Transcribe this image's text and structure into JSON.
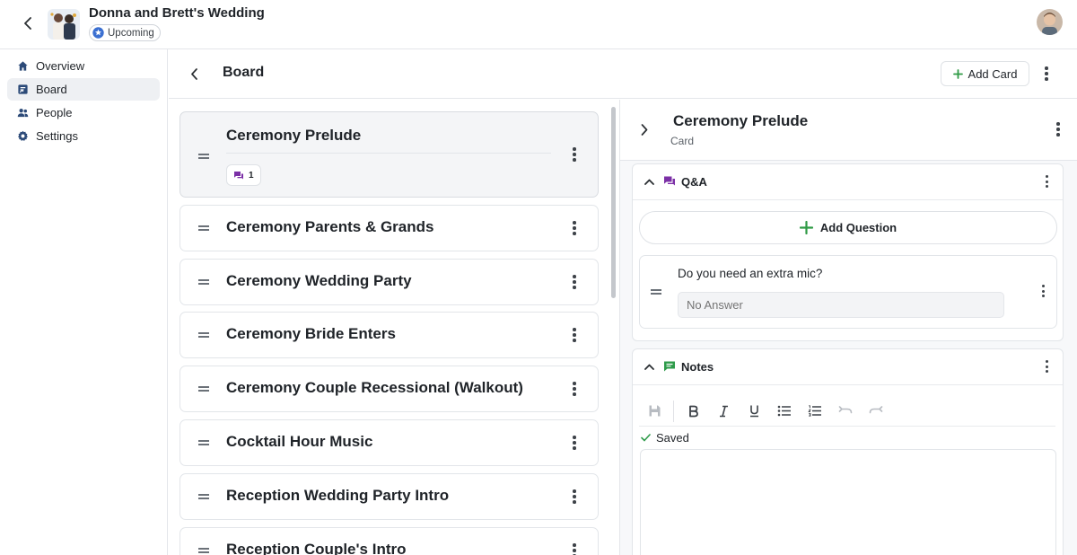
{
  "app": {
    "event_title": "Donna and Brett's Wedding",
    "status": "Upcoming",
    "colors": {
      "accent": "#2f7a3a",
      "qa_purple": "#7b2fa6",
      "notes_green": "#2e9b4a",
      "status_blue": "#3b6fd1"
    }
  },
  "sidebar": {
    "items": [
      {
        "label": "Overview",
        "icon": "home-icon"
      },
      {
        "label": "Board",
        "icon": "board-icon"
      },
      {
        "label": "People",
        "icon": "people-icon"
      },
      {
        "label": "Settings",
        "icon": "gear-icon"
      }
    ],
    "active": "Board"
  },
  "board": {
    "title": "Board",
    "add_card_label": "Add Card",
    "cards": [
      {
        "name": "Ceremony Prelude",
        "qa_count": "1"
      },
      {
        "name": "Ceremony Parents & Grands"
      },
      {
        "name": "Ceremony Wedding Party"
      },
      {
        "name": "Ceremony Bride Enters"
      },
      {
        "name": "Ceremony Couple Recessional (Walkout)"
      },
      {
        "name": "Cocktail Hour Music"
      },
      {
        "name": "Reception Wedding Party Intro"
      },
      {
        "name": "Reception Couple's Intro"
      }
    ]
  },
  "panel": {
    "title": "Ceremony Prelude",
    "subtitle": "Card",
    "qa": {
      "label": "Q&A",
      "add_question_label": "Add Question",
      "questions": [
        {
          "text": "Do you need an extra mic?",
          "answer_placeholder": "No Answer"
        }
      ]
    },
    "notes": {
      "label": "Notes",
      "saved_label": "Saved",
      "toolbar": [
        "save-icon",
        "bold-icon",
        "italic-icon",
        "underline-icon",
        "bullet-list-icon",
        "numbered-list-icon",
        "undo-icon",
        "redo-icon"
      ]
    }
  }
}
